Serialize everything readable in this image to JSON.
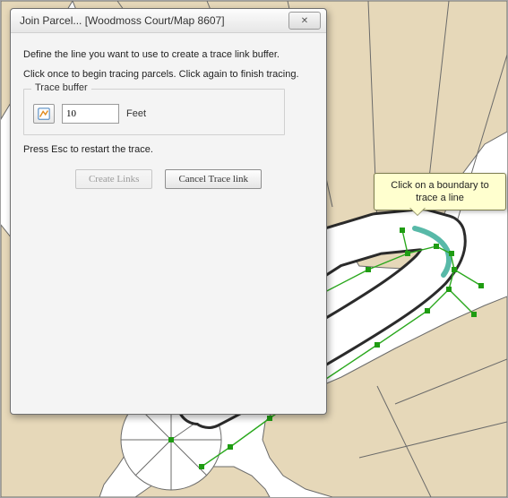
{
  "dialog": {
    "title": "Join Parcel... [Woodmoss Court/Map 8607]",
    "instruction1": "Define the line you want to use to create a trace link buffer.",
    "instruction2": "Click once to begin tracing parcels. Click again to finish tracing.",
    "group_label": "Trace buffer",
    "buffer_value": "10",
    "buffer_unit": "Feet",
    "esc_hint": "Press Esc to restart the trace.",
    "create_links_label": "Create Links",
    "cancel_trace_label": "Cancel Trace link"
  },
  "tooltip": {
    "text": "Click on a boundary to trace a line"
  },
  "colors": {
    "parcel_fill": "#e6d8b9",
    "parcel_stroke": "#6b6b6a",
    "fabric_line": "#2aa81d",
    "node_fill": "#1f9c12",
    "highlight": "#58b9a8"
  }
}
